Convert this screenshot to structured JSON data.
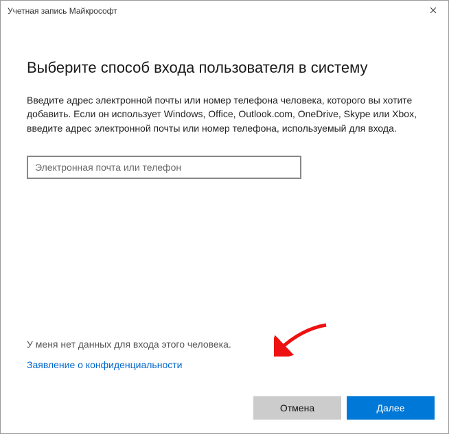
{
  "window": {
    "title": "Учетная запись Майкрософт"
  },
  "main": {
    "heading": "Выберите способ входа пользователя в систему",
    "description": "Введите адрес электронной почты или номер телефона человека, которого вы хотите добавить. Если он использует Windows, Office, Outlook.com, OneDrive, Skype или Xbox, введите адрес электронной почты или номер телефона, используемый для входа.",
    "input_placeholder": "Электронная почта или телефон",
    "no_info_text": "У меня нет данных для входа этого человека.",
    "privacy_link": "Заявление о конфиденциальности"
  },
  "buttons": {
    "cancel": "Отмена",
    "next": "Далее"
  }
}
